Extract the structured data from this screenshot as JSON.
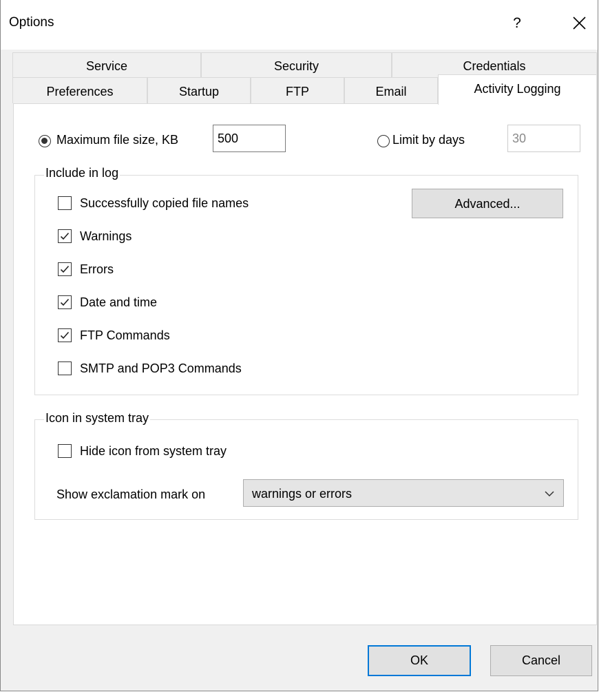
{
  "window": {
    "title": "Options",
    "help_glyph": "?"
  },
  "tabs": {
    "row1": [
      {
        "label": "Service"
      },
      {
        "label": "Security"
      },
      {
        "label": "Credentials"
      }
    ],
    "row2": [
      {
        "label": "Preferences"
      },
      {
        "label": "Startup"
      },
      {
        "label": "FTP"
      },
      {
        "label": "Email"
      },
      {
        "label": "Activity Logging",
        "active": true
      }
    ]
  },
  "limits": {
    "max_size_label": "Maximum file size, KB",
    "max_size_value": "500",
    "max_size_selected": true,
    "days_label": "Limit by days",
    "days_value": "30",
    "days_selected": false
  },
  "include_log": {
    "title": "Include in log",
    "advanced_button": "Advanced...",
    "items": [
      {
        "label": "Successfully copied file names",
        "checked": false
      },
      {
        "label": "Warnings",
        "checked": true
      },
      {
        "label": "Errors",
        "checked": true
      },
      {
        "label": "Date and time",
        "checked": true
      },
      {
        "label": "FTP Commands",
        "checked": true
      },
      {
        "label": "SMTP and POP3 Commands",
        "checked": false
      }
    ]
  },
  "tray": {
    "title": "Icon in system tray",
    "hide_label": "Hide icon from system tray",
    "hide_checked": false,
    "exclaim_label": "Show exclamation mark on",
    "exclaim_value": "warnings or errors"
  },
  "footer": {
    "ok": "OK",
    "cancel": "Cancel"
  },
  "icons": {
    "close": "close-icon",
    "check": "checkmark-icon",
    "dropdown": "chevron-down-icon"
  },
  "colors": {
    "accent": "#0078d7",
    "window_bg": "#f0f0f0",
    "panel_bg": "#ffffff"
  }
}
